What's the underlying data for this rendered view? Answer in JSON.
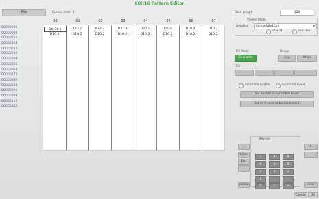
{
  "window": {
    "title": "8Bit16 Pattern Editor"
  },
  "toolbar": {
    "file_label": "File",
    "cursor_addr": "Cursor Addr: 0"
  },
  "grid": {
    "columns": [
      "00",
      "01",
      "02",
      "03",
      "04",
      "05",
      "06",
      "07"
    ],
    "addresses": [
      "00000000",
      "00000008",
      "00000016",
      "00000024",
      "00000032",
      "00000040",
      "00000048",
      "00000056",
      "00000064",
      "00000072",
      "00000080",
      "00000088",
      "00000096",
      "00000104",
      "00000112",
      "00000120"
    ],
    "rows": [
      [
        "1K(24.5",
        "K23.7",
        "K23.7",
        "D31.3",
        "D30.1",
        "D0.2",
        "D10.2",
        "D10.2"
      ],
      [
        "D10.2",
        "D10.2",
        "D10.2",
        "D10.2",
        "D10.2",
        "D10.2",
        "D10.2",
        "D10.2"
      ]
    ]
  },
  "panel": {
    "data_length_label": "Data Length",
    "data_length_value": "128",
    "viewer_mode_label": "Viewer Mode",
    "notation_label": "Notation",
    "notation_value": "Symbol(8b10b)",
    "radio_left": "Bit-Flat",
    "radio_right": "8bit-Hex",
    "fill_mode_label": "Fill Mode",
    "range_label": "Range",
    "fill_mode_button": "Overwrite",
    "range_buttons": [
      "Any",
      "Whole"
    ],
    "fill_label": "Fill",
    "scramble_enable": "Scramble Enable",
    "scramble_reset": "Scramble Reset",
    "set_scramble_button": "Set 8b/10b to Scramble Reset",
    "set_all_button": "Set all 0 code to be Scrambled"
  },
  "keypad": {
    "label": "Keypad",
    "keys": [
      "7",
      "8",
      "9",
      "4",
      "5",
      "6",
      "1",
      "2",
      "3",
      "0",
      ".",
      "-",
      "F",
      "C",
      "+"
    ],
    "side_left": [
      "Clear",
      "Del",
      "Delete"
    ],
    "side_right": [
      "A",
      "Enter"
    ]
  },
  "footer": {
    "cancel_label": "Cancel",
    "ok_label": "OK"
  }
}
